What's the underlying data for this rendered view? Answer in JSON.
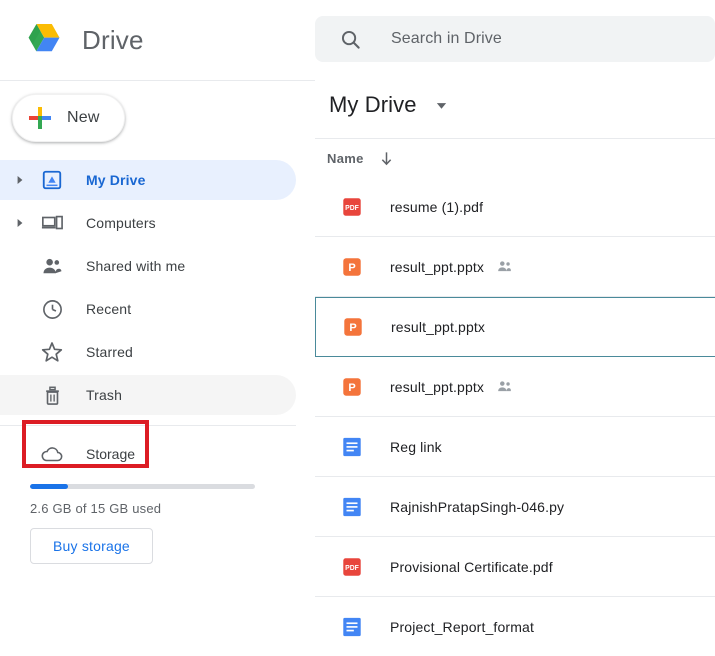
{
  "brand": {
    "title": "Drive",
    "logo_icon": "google-drive-logo",
    "colors": {
      "green": "#34a853",
      "yellow": "#fbbc04",
      "blue": "#4285f4"
    }
  },
  "new_button": {
    "label": "New",
    "icon": "plus-icon"
  },
  "sidebar": {
    "items": [
      {
        "label": "My Drive",
        "icon": "my-drive-icon",
        "name": "my-drive",
        "twisty": true,
        "selected": true,
        "hovered": false
      },
      {
        "label": "Computers",
        "icon": "computers-icon",
        "name": "computers",
        "twisty": true,
        "selected": false,
        "hovered": false
      },
      {
        "label": "Shared with me",
        "icon": "shared-with-me-icon",
        "name": "shared-with-me",
        "twisty": false,
        "selected": false,
        "hovered": false
      },
      {
        "label": "Recent",
        "icon": "clock-icon",
        "name": "recent",
        "twisty": false,
        "selected": false,
        "hovered": false
      },
      {
        "label": "Starred",
        "icon": "star-icon",
        "name": "starred",
        "twisty": false,
        "selected": false,
        "hovered": false
      },
      {
        "label": "Trash",
        "icon": "trash-icon",
        "name": "trash",
        "twisty": false,
        "selected": false,
        "hovered": true
      }
    ],
    "storage": {
      "label": "Storage",
      "icon": "cloud-icon",
      "used_text": "2.6 GB of 15 GB used",
      "percent_used": 17,
      "bar_color": "#1a73e8",
      "buy_label": "Buy storage"
    },
    "annotation": {
      "target": "trash",
      "color": "#dc1c24"
    }
  },
  "search": {
    "placeholder": "Search in Drive",
    "value": "",
    "icon": "search-icon"
  },
  "breadcrumb": {
    "title": "My Drive",
    "caret_icon": "chevron-down-icon"
  },
  "list_header": {
    "name_label": "Name",
    "sort_icon": "arrow-down-icon",
    "sort_direction": "ascending"
  },
  "files": [
    {
      "name": "resume (1).pdf",
      "type": "pdf",
      "shared": false,
      "selected": false
    },
    {
      "name": "result_ppt.pptx",
      "type": "pptx",
      "shared": true,
      "selected": false
    },
    {
      "name": "result_ppt.pptx",
      "type": "pptx",
      "shared": false,
      "selected": true
    },
    {
      "name": "result_ppt.pptx",
      "type": "pptx",
      "shared": true,
      "selected": false
    },
    {
      "name": "Reg link",
      "type": "gdoc",
      "shared": false,
      "selected": false
    },
    {
      "name": "RajnishPratapSingh-046.py",
      "type": "gdoc",
      "shared": false,
      "selected": false
    },
    {
      "name": "Provisional Certificate.pdf",
      "type": "pdf",
      "shared": false,
      "selected": false
    },
    {
      "name": "Project_Report_format",
      "type": "gdoc",
      "shared": false,
      "selected": false
    }
  ],
  "colors": {
    "pdf_icon": "#e8453c",
    "pptx_icon": "#f4743b",
    "gdoc_icon": "#4285f4",
    "selected_row_border": "#4a8a9a",
    "selected_nav_bg": "#e8f0fe",
    "selected_nav_text": "#1967d2",
    "annotation_red": "#dc1c24"
  }
}
